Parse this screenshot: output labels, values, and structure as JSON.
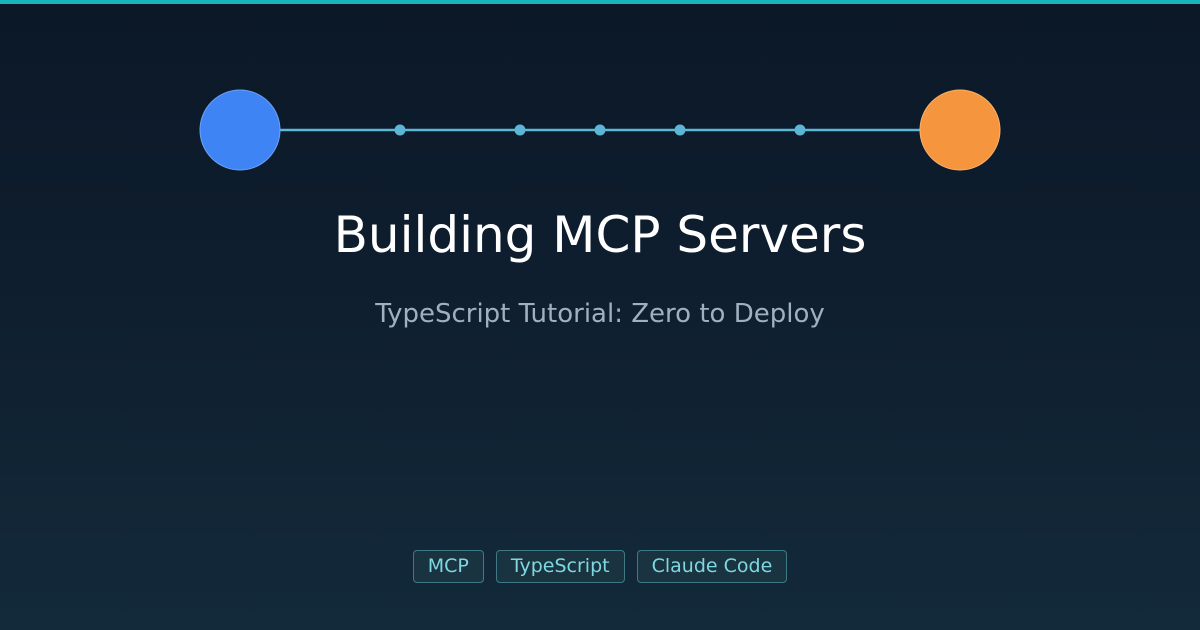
{
  "header": {
    "title": "Building MCP Servers",
    "subtitle": "TypeScript Tutorial: Zero to Deploy"
  },
  "tags": [
    "MCP",
    "TypeScript",
    "Claude Code"
  ],
  "colors": {
    "accent_bar": "#18b6b8",
    "start_node": "#3f84f5",
    "end_node": "#f5963e",
    "connector": "#5db6d6",
    "title_text": "#ffffff",
    "subtitle_text": "#9fb0c2",
    "tag_text": "#7fd8e0",
    "tag_border": "#3d7a86",
    "tag_background": "#1a3340"
  },
  "icons": {
    "start_node": "circle",
    "end_node": "circle",
    "waypoints": "dot"
  }
}
